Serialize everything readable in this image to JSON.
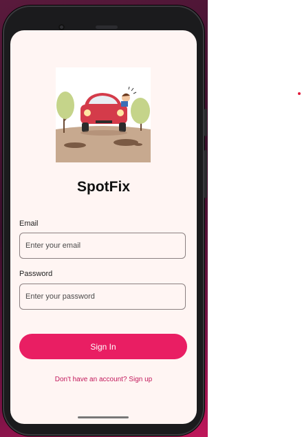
{
  "app": {
    "title": "SpotFix"
  },
  "illustration": {
    "icon": "car-pothole-illustration"
  },
  "login": {
    "email_label": "Email",
    "email_placeholder": "Enter your email",
    "email_value": "",
    "password_label": "Password",
    "password_placeholder": "Enter your password",
    "password_value": "",
    "signin_label": "Sign In",
    "signup_link": "Don't have an account? Sign up"
  },
  "colors": {
    "accent": "#e91e63",
    "link": "#c2185b",
    "screen_bg": "#fff5f3"
  }
}
